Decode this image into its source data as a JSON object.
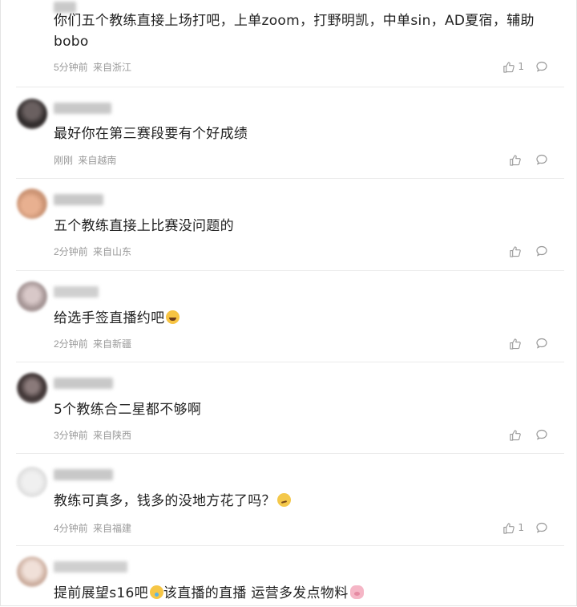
{
  "comments": [
    {
      "text": "你们五个教练直接上场打吧，上单zoom，打野明凯，中单sin，AD夏宿，辅助bobo",
      "time": "5分钟前",
      "location": "来自浙江",
      "likes": "1"
    },
    {
      "text": "最好你在第三赛段要有个好成绩",
      "time": "刚刚",
      "location": "来自越南",
      "likes": ""
    },
    {
      "text": "五个教练直接上比赛没问题的",
      "time": "2分钟前",
      "location": "来自山东",
      "likes": ""
    },
    {
      "text": "给选手签直播约吧",
      "time": "2分钟前",
      "location": "来自新疆",
      "likes": "",
      "emoji": "laughing-emoji"
    },
    {
      "text": "5个教练合二星都不够啊",
      "time": "3分钟前",
      "location": "来自陕西",
      "likes": ""
    },
    {
      "text": "教练可真多，钱多的没地方花了吗？",
      "time": "4分钟前",
      "location": "来自福建",
      "likes": "1",
      "emoji": "smirk-emoji"
    },
    {
      "text_a": "提前展望s16吧",
      "text_b": "该直播的直播 运营多发点物料",
      "emoji_a": "drool-emoji",
      "emoji_b": "pig-emoji"
    }
  ],
  "colors": {
    "meta": "#999999",
    "text": "#222222",
    "divider": "#ebebeb"
  }
}
